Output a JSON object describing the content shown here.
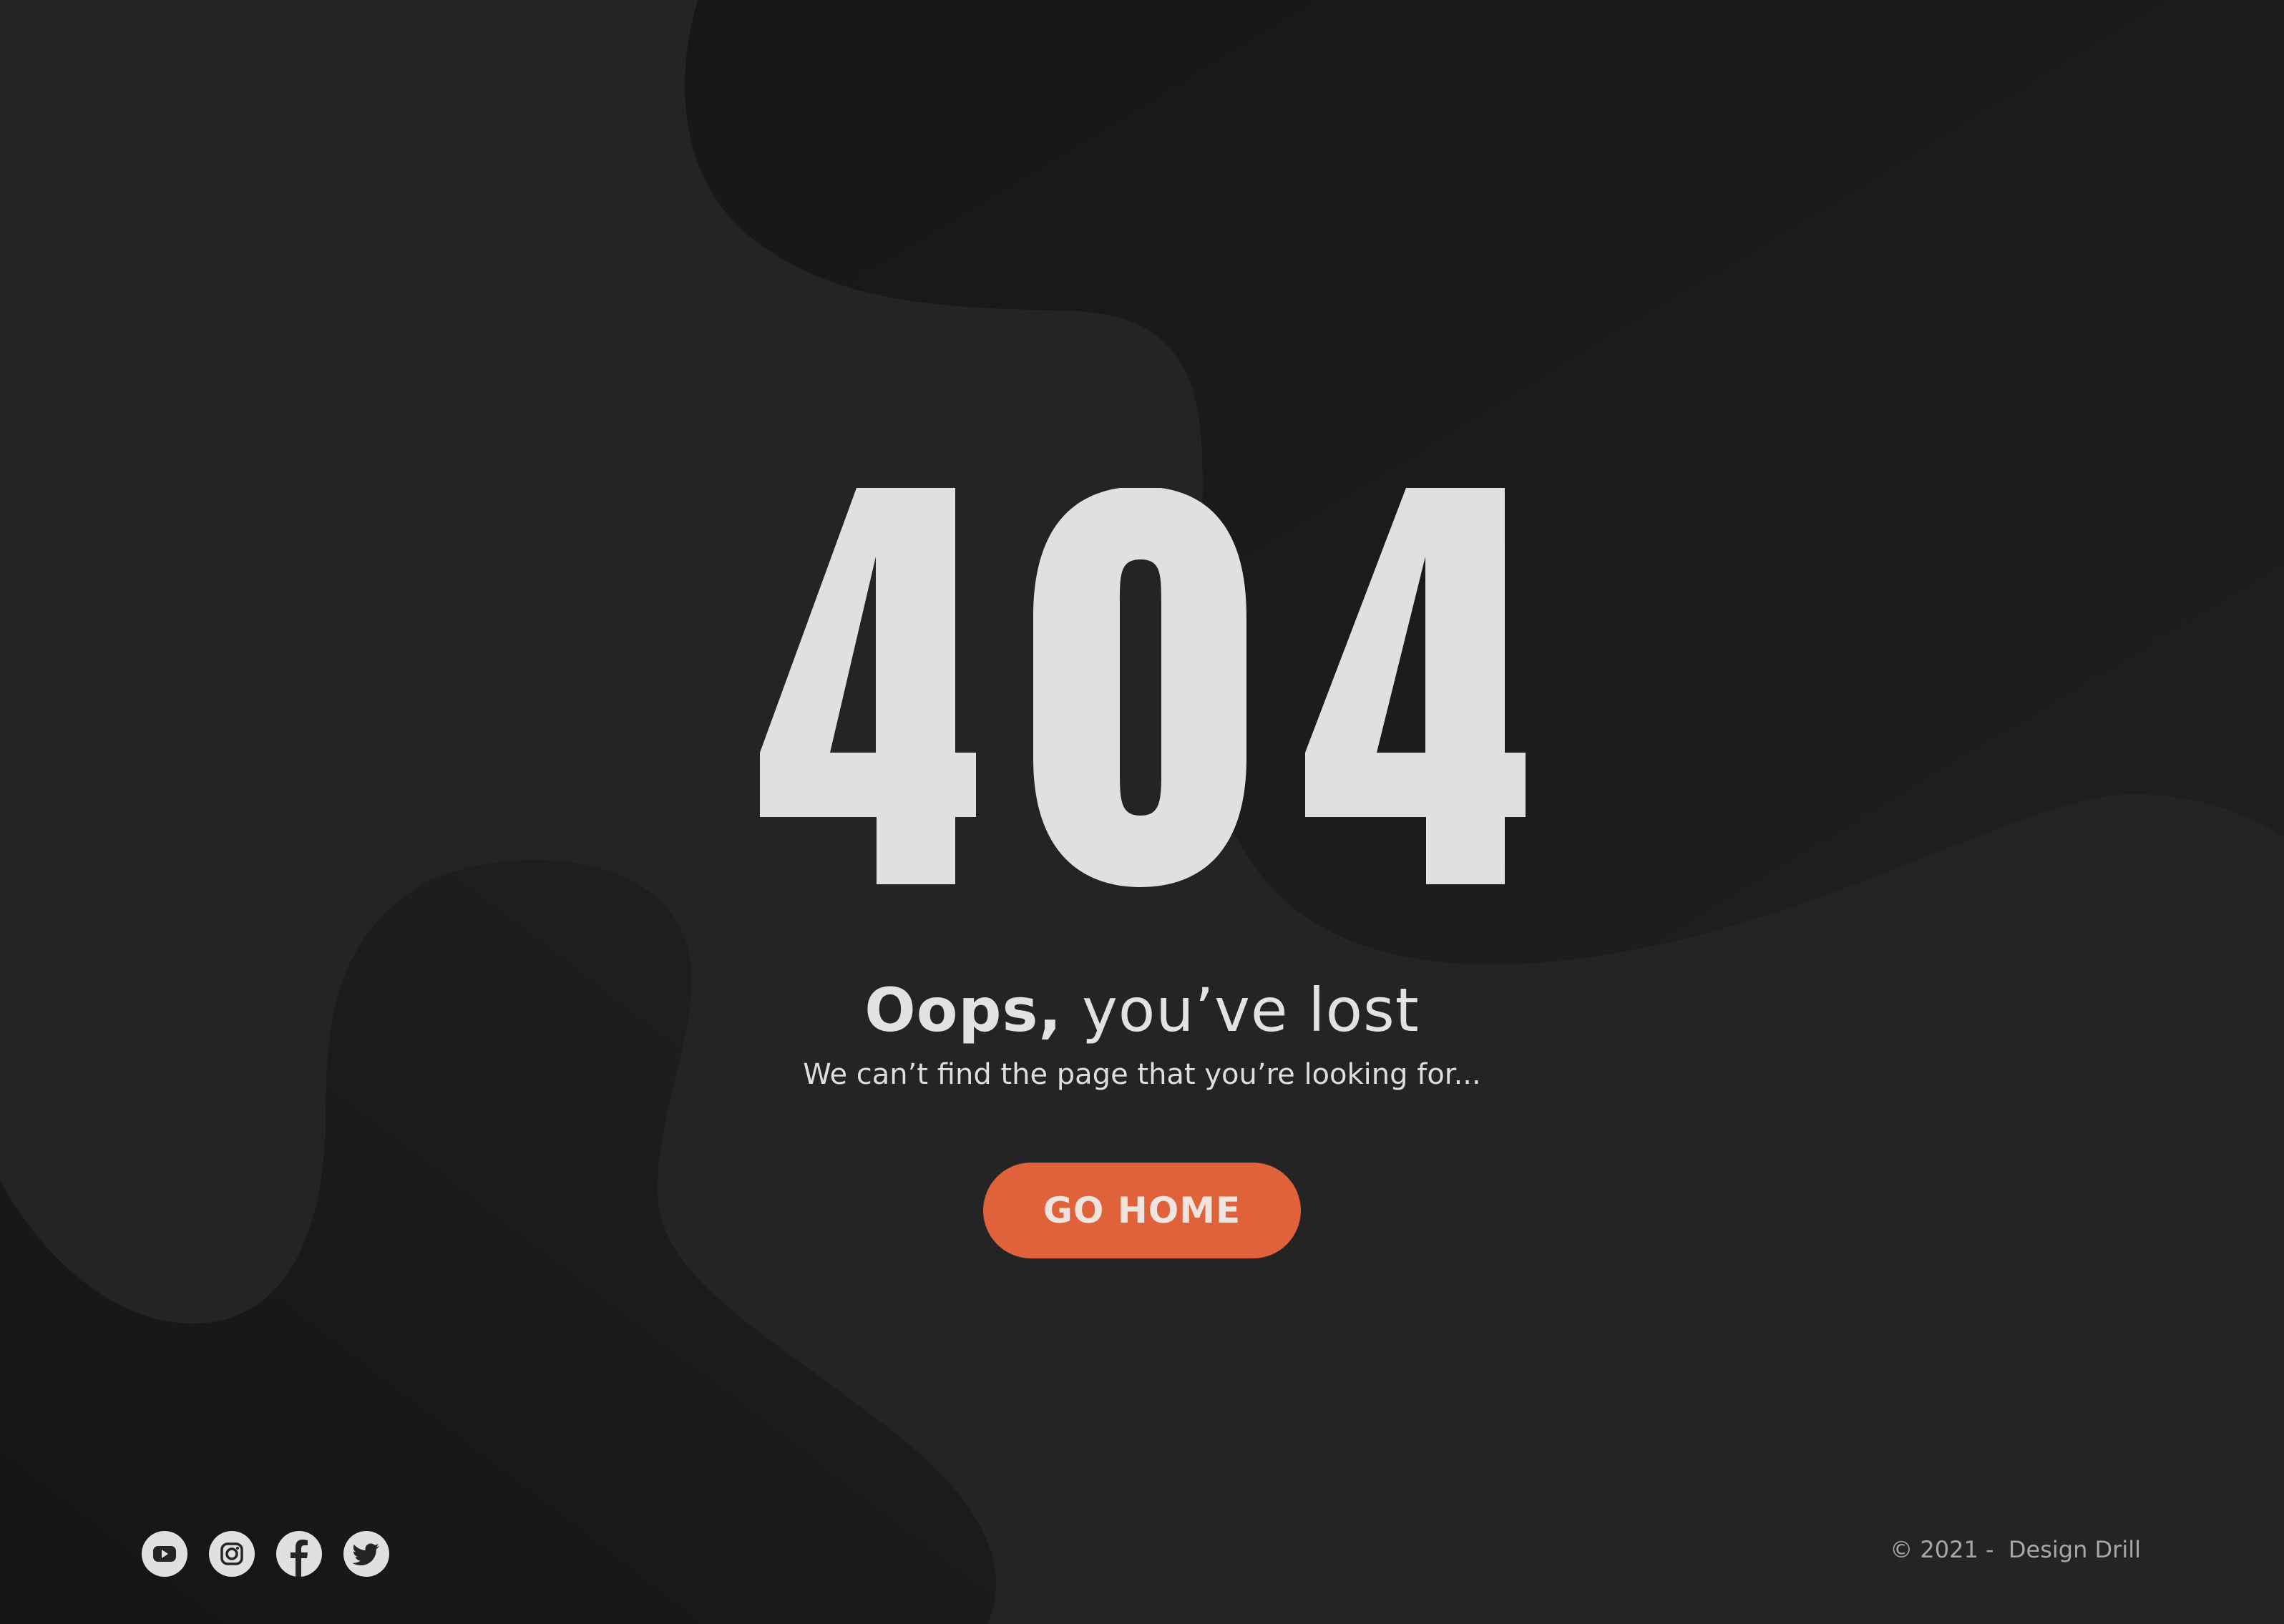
{
  "error_code": "404",
  "headline": {
    "strong": "Oops,",
    "light": "you’ve lost"
  },
  "subtitle": "We can’t find the page that you’re looking for...",
  "button": {
    "label": "GO HOME"
  },
  "social": [
    "youtube-icon",
    "instagram-icon",
    "facebook-icon",
    "twitter-icon"
  ],
  "footer": {
    "copyright": "© 2021 -  Design Drill"
  },
  "colors": {
    "background": "#242424",
    "blob_dark": "#181818",
    "digits": "#e0e0e0",
    "accent": "#e0623a",
    "text": "#e2e2e2"
  }
}
